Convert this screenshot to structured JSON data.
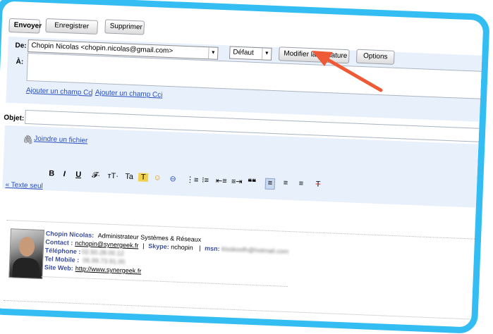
{
  "toolbar": {
    "send_label": "Envoyer",
    "save_label": "Enregistrer",
    "delete_label": "Supprimer"
  },
  "from": {
    "label": "De:",
    "value": "Chopin Nicolas <chopin.nicolas@gmail.com>",
    "format_value": "Défaut",
    "modify_signature_label": "Modifier la signature",
    "options_label": "Options"
  },
  "to": {
    "label": "À:",
    "value": "",
    "add_cc": "Ajouter un champ Cc",
    "separator": "|",
    "add_bcc": "Ajouter un champ Cci"
  },
  "subject": {
    "label": "Objet:",
    "value": "",
    "attach": "Joindre un fichier"
  },
  "format": {
    "plain_text_link": "« Texte seul",
    "buttons": [
      "B",
      "I",
      "U",
      "𝓕·",
      "тT·",
      "Ta",
      "T",
      "☺",
      "⊖",
      "⋮≡",
      "⁝≡",
      "⇤≡",
      "≡⇥",
      "❝❝",
      "≡",
      "≡",
      "≡",
      "T"
    ]
  },
  "signature": {
    "name_label": "Chopin Nicolas:",
    "role": "Administrateur Systèmes & Réseaux",
    "contact_label": "Contact :",
    "contact_value": "nchopin@synergeek.fr",
    "pipe1": "|",
    "skype_label": "Skype:",
    "skype_value": "nchopin",
    "pipe2": "|",
    "msn_label": "msn:",
    "msn_value": "kisskoofh@hotmail.com",
    "phone_label": "Téléphone :",
    "phone_value": "02.50.28.00.12",
    "mobile_label": "Tel Mobile :",
    "mobile_value": "06.99.73.91.00",
    "web_label": "Site Web:",
    "web_value": "http://www.synergeek.fr"
  },
  "colors": {
    "frame": "#33bdf2",
    "panel": "#e8f0fb",
    "arrow": "#ef5a36",
    "link": "#2a4fbf"
  }
}
